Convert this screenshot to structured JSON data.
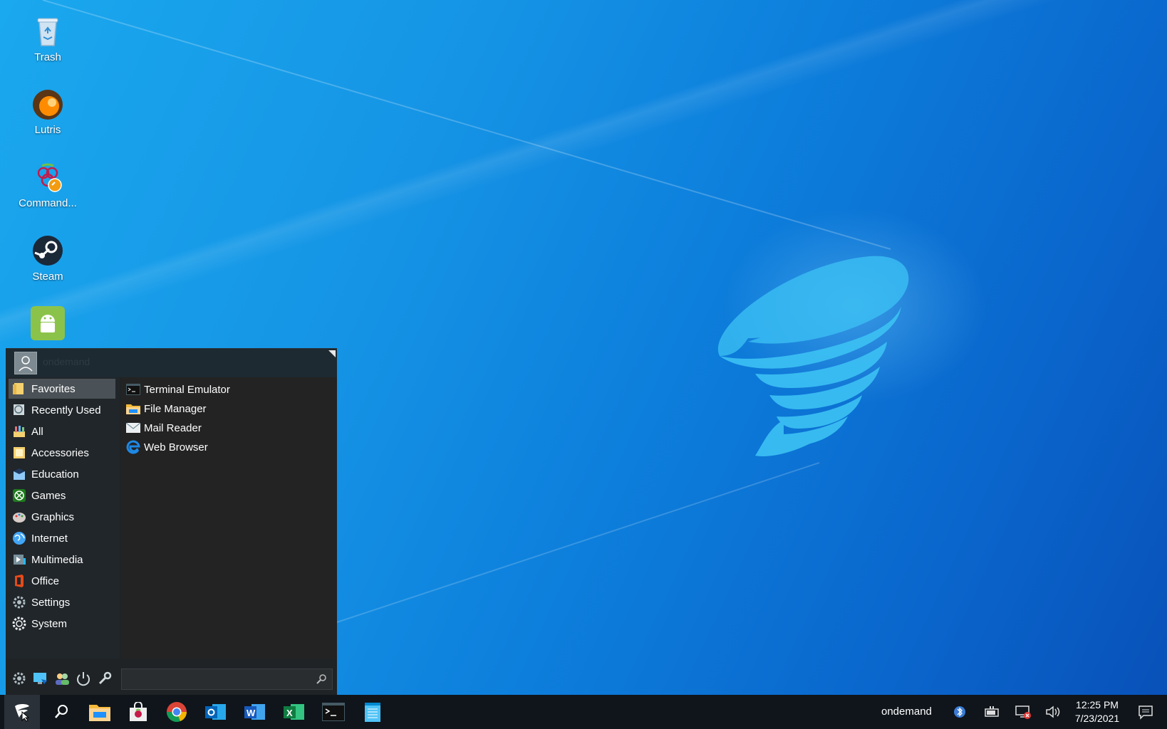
{
  "desktop": {
    "icons": [
      {
        "label": "Trash",
        "icon": "trash-icon"
      },
      {
        "label": "Lutris",
        "icon": "lutris-icon"
      },
      {
        "label": "Command...",
        "icon": "raspberry-command-icon"
      },
      {
        "label": "Steam",
        "icon": "steam-icon"
      },
      {
        "label": "",
        "icon": "android-icon"
      }
    ]
  },
  "start_menu": {
    "username": "ondemand",
    "categories": [
      {
        "label": "Favorites",
        "icon": "favorites-icon",
        "selected": true
      },
      {
        "label": "Recently Used",
        "icon": "recently-used-icon"
      },
      {
        "label": "All",
        "icon": "all-apps-icon"
      },
      {
        "label": "Accessories",
        "icon": "accessories-icon"
      },
      {
        "label": "Education",
        "icon": "education-icon"
      },
      {
        "label": "Games",
        "icon": "games-icon"
      },
      {
        "label": "Graphics",
        "icon": "graphics-icon"
      },
      {
        "label": "Internet",
        "icon": "internet-icon"
      },
      {
        "label": "Multimedia",
        "icon": "multimedia-icon"
      },
      {
        "label": "Office",
        "icon": "office-icon"
      },
      {
        "label": "Settings",
        "icon": "settings-icon"
      },
      {
        "label": "System",
        "icon": "system-icon"
      }
    ],
    "apps": [
      {
        "label": "Terminal Emulator",
        "icon": "terminal-icon"
      },
      {
        "label": "File Manager",
        "icon": "folder-icon"
      },
      {
        "label": "Mail Reader",
        "icon": "mail-icon"
      },
      {
        "label": "Web Browser",
        "icon": "edge-browser-icon"
      }
    ],
    "search_placeholder": ""
  },
  "taskbar": {
    "pinned": [
      "start-icon",
      "search-icon",
      "file-explorer-icon",
      "store-icon",
      "chrome-icon",
      "outlook-icon",
      "word-icon",
      "excel-icon",
      "terminal-icon",
      "notepad-icon"
    ],
    "tray_label": "ondemand",
    "time": "12:25 PM",
    "date": "7/23/2021"
  },
  "colors": {
    "accent": "#1a8fe3",
    "taskbar": "#0f151b",
    "menu_bg": "#21262a",
    "menu_selected": "#4b5257"
  }
}
